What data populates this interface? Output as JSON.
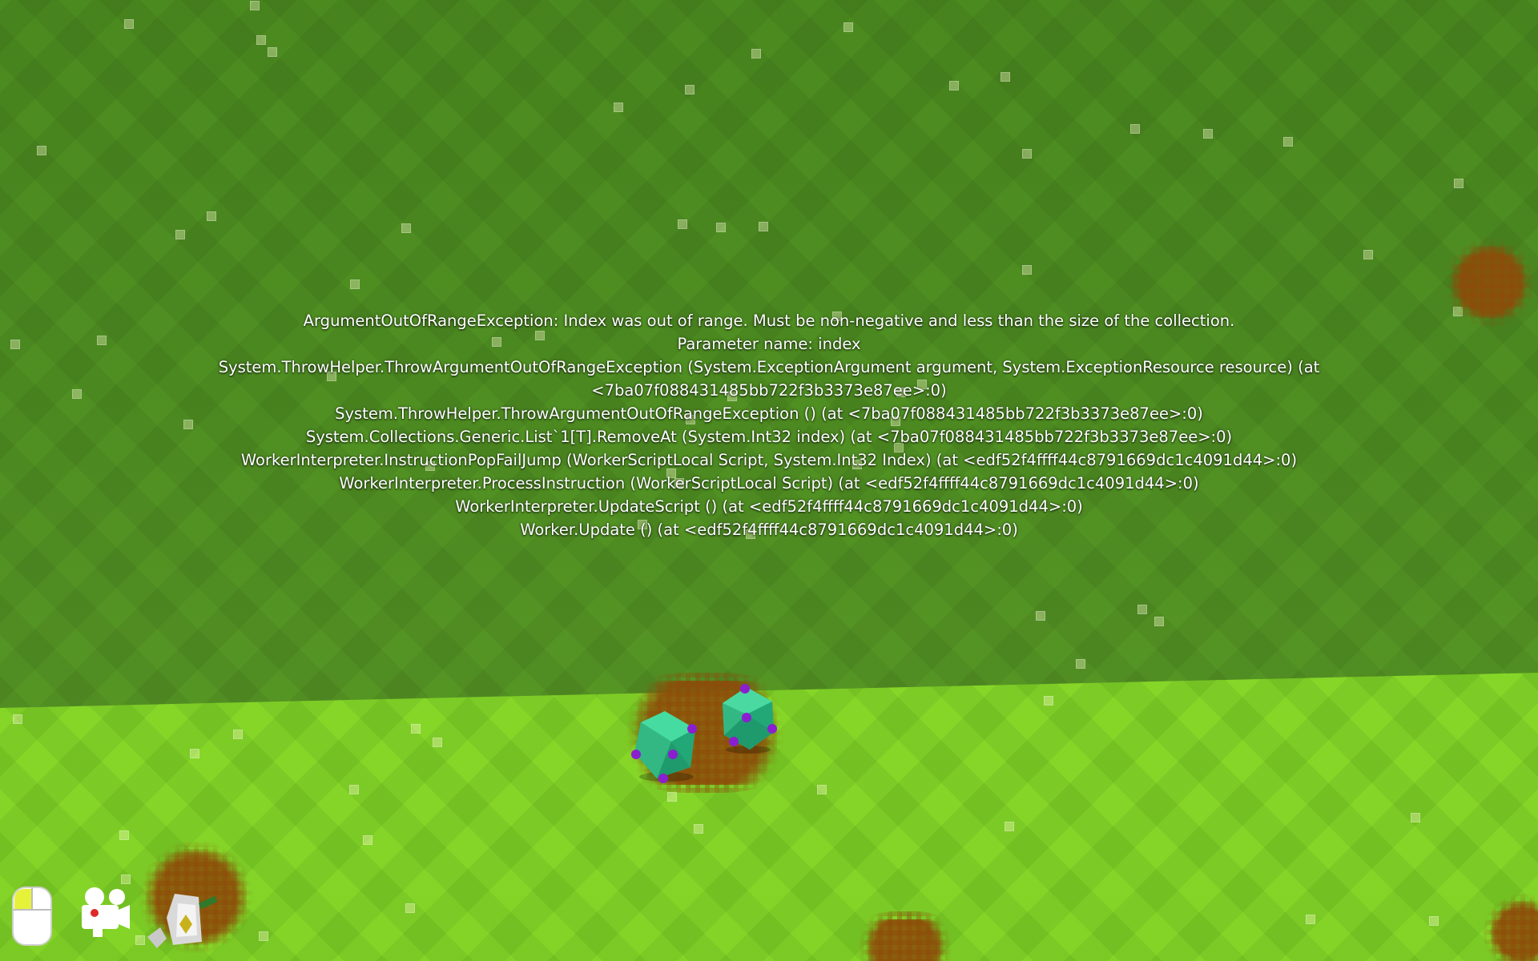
{
  "error": {
    "lines": [
      "ArgumentOutOfRangeException: Index was out of range. Must be non-negative and less than the size of the collection.",
      "Parameter name: index",
      "System.ThrowHelper.ThrowArgumentOutOfRangeException (System.ExceptionArgument argument, System.ExceptionResource resource) (at",
      "<7ba07f088431485bb722f3b3373e87ee>:0)",
      "System.ThrowHelper.ThrowArgumentOutOfRangeException () (at <7ba07f088431485bb722f3b3373e87ee>:0)",
      "System.Collections.Generic.List`1[T].RemoveAt (System.Int32 index) (at <7ba07f088431485bb722f3b3373e87ee>:0)",
      "WorkerInterpreter.InstructionPopFailJump (WorkerScriptLocal Script, System.Int32 Index) (at <edf52f4ffff44c8791669dc1c4091d44>:0)",
      "WorkerInterpreter.ProcessInstruction (WorkerScriptLocal Script) (at <edf52f4ffff44c8791669dc1c4091d44>:0)",
      "WorkerInterpreter.UpdateScript () (at <edf52f4ffff44c8791669dc1c4091d44>:0)",
      "Worker.Update () (at <edf52f4ffff44c8791669dc1c4091d44>:0)"
    ]
  },
  "toolbar": {
    "tools": [
      "mouse-tool-icon",
      "camera-tool-icon",
      "worker-tool-icon"
    ]
  },
  "colors": {
    "grass_dark": "#4f8f22",
    "grass_bright": "#88d829",
    "dirt": "#8c5014",
    "plant": "#2ec48a",
    "berry": "#8a1fd0"
  }
}
